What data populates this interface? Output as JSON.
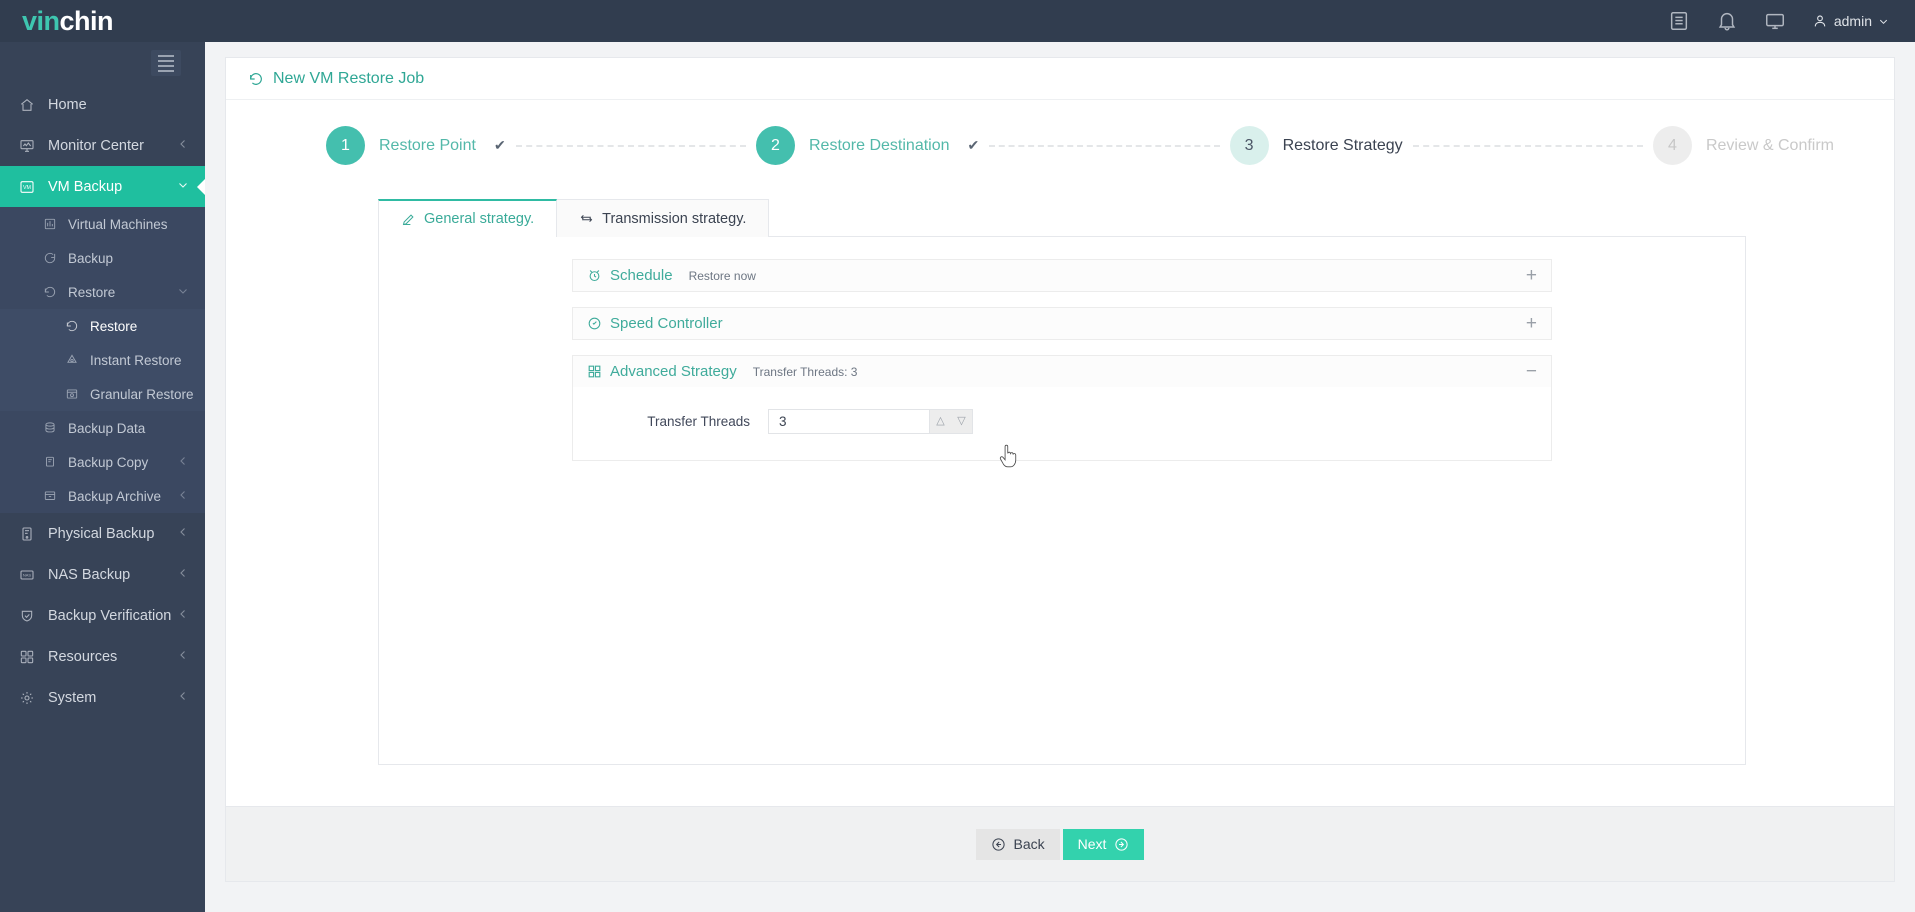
{
  "topbar": {
    "logo_prefix": "vin",
    "logo_suffix": "chin",
    "icons": [
      "list-icon",
      "bell-icon",
      "monitor-icon"
    ],
    "user_label": "admin"
  },
  "sidebar": {
    "items": [
      {
        "label": "Home",
        "icon": "home-icon",
        "level": 1,
        "state": "normal",
        "chevron": ""
      },
      {
        "label": "Monitor Center",
        "icon": "monitor-chart-icon",
        "level": 1,
        "state": "normal",
        "chevron": "left"
      },
      {
        "label": "VM Backup",
        "icon": "vm-icon",
        "level": 1,
        "state": "active",
        "chevron": "down"
      },
      {
        "label": "Virtual Machines",
        "icon": "vm-list-icon",
        "level": 2,
        "state": "normal",
        "chevron": ""
      },
      {
        "label": "Backup",
        "icon": "backup-icon",
        "level": 2,
        "state": "normal",
        "chevron": ""
      },
      {
        "label": "Restore",
        "icon": "restore-icon",
        "level": 2,
        "state": "normal",
        "chevron": "down"
      },
      {
        "label": "Restore",
        "icon": "restore-icon",
        "level": 3,
        "state": "selected",
        "chevron": ""
      },
      {
        "label": "Instant Restore",
        "icon": "instant-restore-icon",
        "level": 3,
        "state": "normal",
        "chevron": ""
      },
      {
        "label": "Granular Restore",
        "icon": "granular-restore-icon",
        "level": 3,
        "state": "normal",
        "chevron": ""
      },
      {
        "label": "Backup Data",
        "icon": "database-icon",
        "level": 2,
        "state": "normal",
        "chevron": ""
      },
      {
        "label": "Backup Copy",
        "icon": "copy-icon",
        "level": 2,
        "state": "normal",
        "chevron": "left"
      },
      {
        "label": "Backup Archive",
        "icon": "archive-icon",
        "level": 2,
        "state": "normal",
        "chevron": "left"
      },
      {
        "label": "Physical Backup",
        "icon": "server-icon",
        "level": 1,
        "state": "normal",
        "chevron": "left"
      },
      {
        "label": "NAS Backup",
        "icon": "nas-icon",
        "level": 1,
        "state": "normal",
        "chevron": "left"
      },
      {
        "label": "Backup Verification",
        "icon": "verify-shield-icon",
        "level": 1,
        "state": "normal",
        "chevron": "left"
      },
      {
        "label": "Resources",
        "icon": "grid-icon",
        "level": 1,
        "state": "normal",
        "chevron": "left"
      },
      {
        "label": "System",
        "icon": "gear-icon",
        "level": 1,
        "state": "normal",
        "chevron": "left"
      }
    ]
  },
  "page": {
    "title": "New VM Restore Job",
    "title_icon": "restore-icon"
  },
  "steps": [
    {
      "number": "1",
      "label": "Restore Point",
      "state": "done",
      "check": "✔"
    },
    {
      "number": "2",
      "label": "Restore Destination",
      "state": "done",
      "check": "✔"
    },
    {
      "number": "3",
      "label": "Restore Strategy",
      "state": "current",
      "check": ""
    },
    {
      "number": "4",
      "label": "Review & Confirm",
      "state": "todo",
      "check": ""
    }
  ],
  "tabs": [
    {
      "label": "General strategy.",
      "icon": "pencil-icon",
      "active": true
    },
    {
      "label": "Transmission strategy.",
      "icon": "transfer-icon",
      "active": false
    }
  ],
  "sections": [
    {
      "title": "Schedule",
      "icon": "alarm-clock-icon",
      "summary": "Restore now",
      "toggle": "+",
      "expanded": false
    },
    {
      "title": "Speed Controller",
      "icon": "gauge-icon",
      "summary": "",
      "toggle": "+",
      "expanded": false
    },
    {
      "title": "Advanced Strategy",
      "icon": "grid-icon",
      "summary": "Transfer Threads: 3",
      "toggle": "−",
      "expanded": true
    }
  ],
  "advanced": {
    "field_label": "Transfer Threads",
    "field_value": "3",
    "up_icon": "chevron-up-icon",
    "down_icon": "chevron-down-icon"
  },
  "footer": {
    "back_label": "Back",
    "next_label": "Next",
    "back_icon": "arrow-left-circle-icon",
    "next_icon": "arrow-right-circle-icon"
  },
  "colors": {
    "accent": "#2fbba3",
    "accent_button": "#33d2ad",
    "sidebar_bg": "#374357",
    "topbar_bg": "#313d4f",
    "step_done": "#44bfae",
    "step_current": "#d9f0ec"
  }
}
